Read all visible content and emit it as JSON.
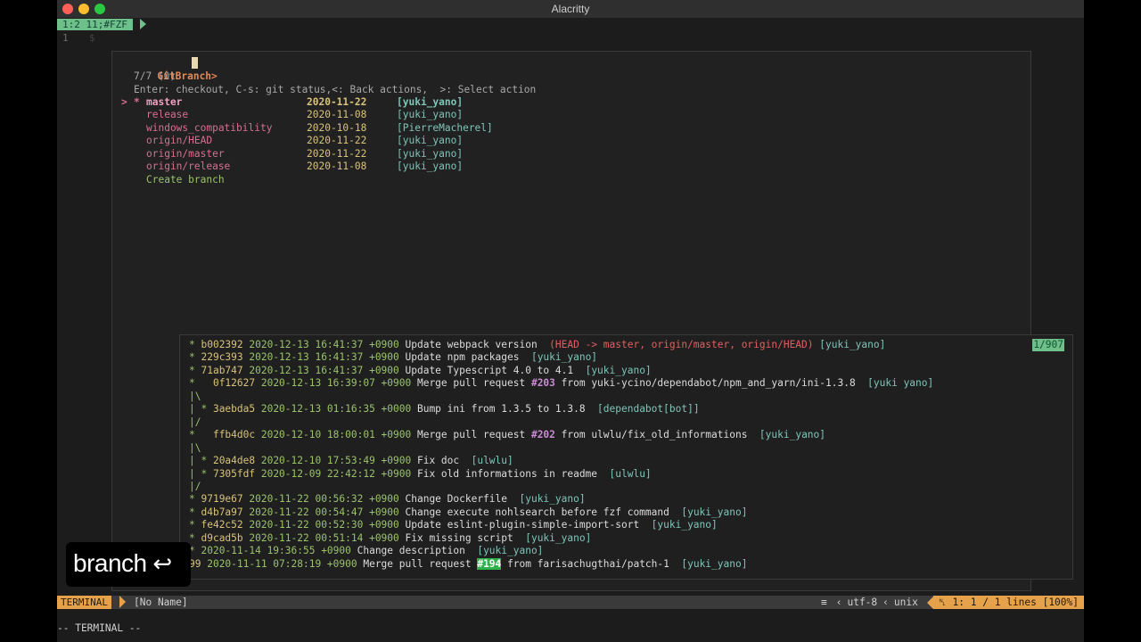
{
  "window": {
    "title": "Alacritty"
  },
  "tabline": {
    "tab_label": "1:2 11;#FZF",
    "line_number": "1",
    "prompt_char": "$"
  },
  "fzf": {
    "prompt": "GitBranch>",
    "count": "7/7 (0)",
    "help": "Enter: checkout, C-s: git status,<: Back actions,  >: Select action",
    "branches": [
      {
        "pointer": ">",
        "mark": "*",
        "name": "master",
        "date": "2020-11-22",
        "author": "[yuki_yano]"
      },
      {
        "pointer": "",
        "mark": "",
        "name": "release",
        "date": "2020-11-08",
        "author": "[yuki_yano]"
      },
      {
        "pointer": "",
        "mark": "",
        "name": "windows_compatibility",
        "date": "2020-10-18",
        "author": "[PierreMacherel]"
      },
      {
        "pointer": "",
        "mark": "",
        "name": "origin/HEAD",
        "date": "2020-11-22",
        "author": "[yuki_yano]"
      },
      {
        "pointer": "",
        "mark": "",
        "name": "origin/master",
        "date": "2020-11-22",
        "author": "[yuki_yano]"
      },
      {
        "pointer": "",
        "mark": "",
        "name": "origin/release",
        "date": "2020-11-08",
        "author": "[yuki_yano]"
      }
    ],
    "create_branch": "Create branch"
  },
  "preview": {
    "counter": "1/907",
    "lines": [
      {
        "graph": "* ",
        "hash": "b002392",
        "date": "2020-12-13 16:41:37 +0900",
        "msg": "Update webpack version",
        "ref": "(HEAD -> master, origin/master, origin/HEAD)",
        "author": "[yuki_yano]"
      },
      {
        "graph": "* ",
        "hash": "229c393",
        "date": "2020-12-13 16:41:37 +0900",
        "msg": "Update npm packages",
        "author": "[yuki_yano]"
      },
      {
        "graph": "* ",
        "hash": "71ab747",
        "date": "2020-12-13 16:41:37 +0900",
        "msg": "Update Typescript 4.0 to 4.1",
        "author": "[yuki_yano]"
      },
      {
        "graph": "*   ",
        "hash": "0f12627",
        "date": "2020-12-13 16:39:07 +0900",
        "msg_pre": "Merge pull request",
        "pr": "#203",
        "msg_post": "from yuki-ycino/dependabot/npm_and_yarn/ini-1.3.8",
        "author": "[yuki yano]"
      },
      {
        "graph": "|\\"
      },
      {
        "graph": "| * ",
        "hash": "3aebda5",
        "date": "2020-12-13 01:16:35 +0000",
        "msg": "Bump ini from 1.3.5 to 1.3.8",
        "author": "[dependabot[bot]]"
      },
      {
        "graph": "|/"
      },
      {
        "graph": "*   ",
        "hash": "ffb4d0c",
        "date": "2020-12-10 18:00:01 +0900",
        "msg_pre": "Merge pull request",
        "pr": "#202",
        "msg_post": "from ulwlu/fix_old_informations",
        "author": "[yuki_yano]"
      },
      {
        "graph": "|\\"
      },
      {
        "graph": "| * ",
        "hash": "20a4de8",
        "date": "2020-12-10 17:53:49 +0900",
        "msg": "Fix doc",
        "author": "[ulwlu]"
      },
      {
        "graph": "| * ",
        "hash": "7305fdf",
        "date": "2020-12-09 22:42:12 +0900",
        "msg": "Fix old informations in readme",
        "author": "[ulwlu]"
      },
      {
        "graph": "|/"
      },
      {
        "graph": "* ",
        "hash": "9719e67",
        "date": "2020-11-22 00:56:32 +0900",
        "msg": "Change Dockerfile",
        "author": "[yuki_yano]"
      },
      {
        "graph": "* ",
        "hash": "d4b7a97",
        "date": "2020-11-22 00:54:47 +0900",
        "msg": "Change execute nohlsearch before fzf command",
        "author": "[yuki_yano]"
      },
      {
        "graph": "* ",
        "hash": "fe42c52",
        "date": "2020-11-22 00:52:30 +0900",
        "msg": "Update eslint-plugin-simple-import-sort",
        "author": "[yuki_yano]"
      },
      {
        "graph": "* ",
        "hash": "d9cad5b",
        "date": "2020-11-22 00:51:14 +0900",
        "msg": "Fix missing script",
        "author": "[yuki_yano]"
      },
      {
        "graph": "* ",
        "hash": "",
        "date": "2020-11-14 19:36:55 +0900",
        "msg": "Change description",
        "author": "[yuki_yano]"
      },
      {
        "graph": "",
        "hash": "99",
        "date": "2020-11-11 07:28:19 +0900",
        "msg_pre": "Merge pull request",
        "pr": "#194",
        "msg_post": "from farisachugthai/patch-1",
        "author": "[yuki_yano]"
      }
    ]
  },
  "statusline": {
    "mode": "TERMINAL",
    "filename": "[No Name]",
    "encoding": "utf-8",
    "format": "unix",
    "position": "1: 1 / 1 lines [100%]"
  },
  "cmdline": {
    "text": "-- TERMINAL --"
  },
  "overlay": {
    "text": "branch",
    "icon": "return-arrow-icon"
  },
  "colors": {
    "accent_green": "#6fbf8a",
    "mode_orange": "#e5a24a",
    "red": "#e06060"
  }
}
